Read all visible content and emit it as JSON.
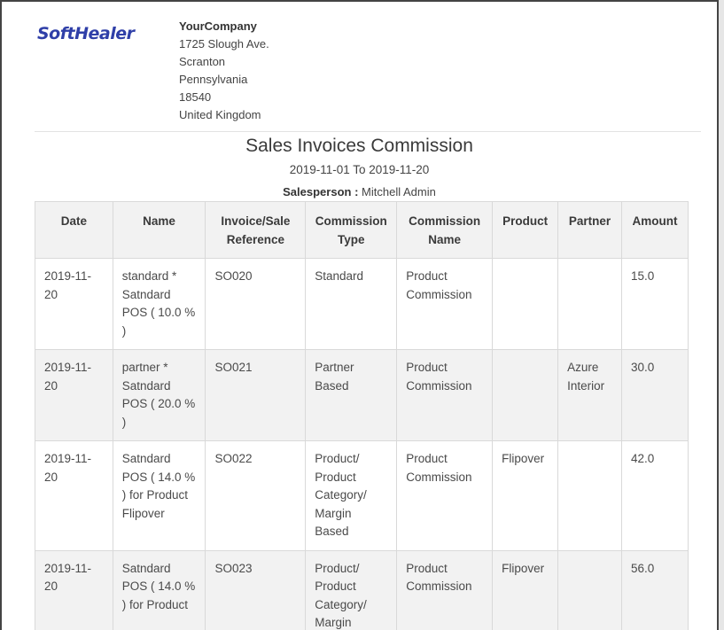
{
  "logo": {
    "text": "SoftHealer"
  },
  "company": {
    "name": "YourCompany",
    "address_lines": [
      "1725 Slough Ave.",
      "Scranton",
      "Pennsylvania",
      "18540",
      "United Kingdom"
    ]
  },
  "report": {
    "title": "Sales Invoices Commission",
    "date_range": "2019-11-01 To 2019-11-20",
    "salesperson_label": "Salesperson :",
    "salesperson_name": "Mitchell Admin"
  },
  "table": {
    "columns": [
      "Date",
      "Name",
      "Invoice/Sale Reference",
      "Commission Type",
      "Commission Name",
      "Product",
      "Partner",
      "Amount"
    ],
    "rows": [
      {
        "date": "2019-11-20",
        "name": "standard * Satndard POS ( 10.0 % )",
        "reference": "SO020",
        "commission_type": "Standard",
        "commission_name": "Product Commission",
        "product": "",
        "partner": "",
        "amount": "15.0"
      },
      {
        "date": "2019-11-20",
        "name": "partner * Satndard POS ( 20.0 % )",
        "reference": "SO021",
        "commission_type": "Partner Based",
        "commission_name": "Product Commission",
        "product": "",
        "partner": "Azure Interior",
        "amount": "30.0"
      },
      {
        "date": "2019-11-20",
        "name": "Satndard POS ( 14.0 % ) for Product Flipover",
        "reference": "SO022",
        "commission_type": "Product/ Product Category/ Margin Based",
        "commission_name": "Product Commission",
        "product": "Flipover",
        "partner": "",
        "amount": "42.0"
      },
      {
        "date": "2019-11-20",
        "name": "Satndard POS ( 14.0 % ) for Product",
        "reference": "SO023",
        "commission_type": "Product/ Product Category/ Margin",
        "commission_name": "Product Commission",
        "product": "Flipover",
        "partner": "",
        "amount": "56.0"
      }
    ]
  }
}
